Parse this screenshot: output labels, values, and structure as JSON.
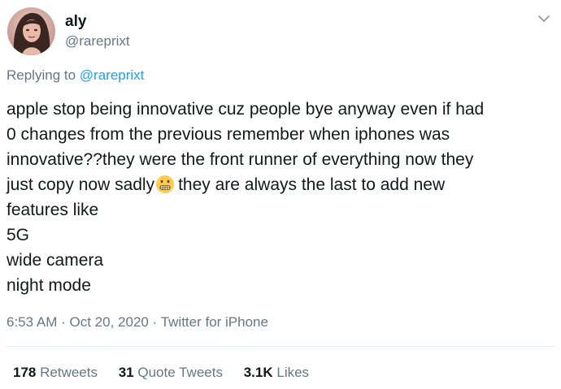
{
  "author": {
    "display_name": "aly",
    "handle": "@rareprixt",
    "avatar_icon": "profile-photo"
  },
  "menu_icon": "chevron-down-icon",
  "reply": {
    "prefix": "Replying to",
    "mention": "@rareprixt"
  },
  "tweet": {
    "lines": [
      "apple stop being innovative cuz people bye anyway even if had",
      "0 changes from the previous remember when iphones was",
      "innovative??they were the front runner of everything now they",
      "just copy now sadly",
      "they are always the last to add new",
      "features like",
      "5G",
      "wide camera",
      "night mode"
    ],
    "emoji": "grimacing-face"
  },
  "meta": {
    "time": "6:53 AM",
    "separator1": "·",
    "date": "Oct 20, 2020",
    "separator2": "·",
    "source": "Twitter for iPhone"
  },
  "stats": {
    "retweets_count": "178",
    "retweets_label": "Retweets",
    "quotes_count": "31",
    "quotes_label": "Quote Tweets",
    "likes_count": "3.1K",
    "likes_label": "Likes"
  },
  "colors": {
    "text": "#14171a",
    "secondary": "#657786",
    "link": "#1da1f2",
    "divider": "#e6ecf0"
  }
}
